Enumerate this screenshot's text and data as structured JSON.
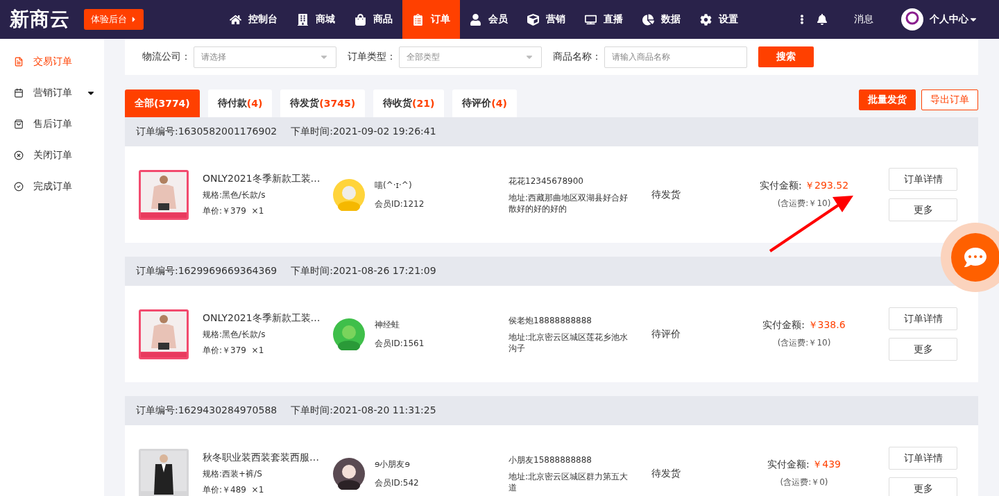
{
  "header": {
    "logo": "新商云",
    "trial_button": "体验后台",
    "nav": [
      {
        "label": "控制台",
        "selected": false
      },
      {
        "label": "商城",
        "selected": false
      },
      {
        "label": "商品",
        "selected": false
      },
      {
        "label": "订单",
        "selected": true
      },
      {
        "label": "会员",
        "selected": false
      },
      {
        "label": "营销",
        "selected": false
      },
      {
        "label": "直播",
        "selected": false
      },
      {
        "label": "数据",
        "selected": false
      },
      {
        "label": "设置",
        "selected": false
      }
    ],
    "messages": "消息",
    "user_menu": "个人中心"
  },
  "sidebar": {
    "items": [
      {
        "label": "交易订单",
        "selected": true,
        "has_submenu": false
      },
      {
        "label": "营销订单",
        "selected": false,
        "has_submenu": true
      },
      {
        "label": "售后订单",
        "selected": false,
        "has_submenu": false
      },
      {
        "label": "关闭订单",
        "selected": false,
        "has_submenu": false
      },
      {
        "label": "完成订单",
        "selected": false,
        "has_submenu": false
      }
    ]
  },
  "filters": [
    {
      "kind": "select",
      "label": "物流公司：",
      "placeholder": "请选择"
    },
    {
      "kind": "select",
      "label": "订单类型：",
      "placeholder": "全部类型"
    },
    {
      "kind": "input",
      "label": "商品名称：",
      "placeholder": "请输入商品名称"
    }
  ],
  "search_button": "搜索",
  "tabs": [
    {
      "label": "全部",
      "count": "(3774)",
      "selected": true
    },
    {
      "label": "待付款",
      "count": "(4)",
      "selected": false
    },
    {
      "label": "待发货",
      "count": "(3745)",
      "selected": false
    },
    {
      "label": "待收货",
      "count": "(21)",
      "selected": false
    },
    {
      "label": "待评价",
      "count": "(4)",
      "selected": false
    }
  ],
  "actions": [
    {
      "label": "批量发货",
      "kind": "primary"
    },
    {
      "label": "导出订单",
      "kind": "outline"
    }
  ],
  "orders": [
    {
      "order_no": "订单编号:1630582001176902",
      "order_time": "下单时间:2021-09-02 19:26:41",
      "product": "ONLY2021冬季新款工装…",
      "spec": "规格:黑色/长款/s",
      "price": "单价:￥379  ×1",
      "member": "喵(^·ɪ·^)",
      "member_id": "会员ID:1212",
      "contact": "花花12345678900",
      "address": "地址:西藏那曲地区双湖县好合好散好的好的好的",
      "status": "待发货",
      "paid_label": "实付金额:",
      "paid": "￥293.52",
      "shipping": "(含运费:￥10)",
      "buttons": [
        "订单详情",
        "更多"
      ]
    },
    {
      "order_no": "订单编号:1629969669364369",
      "order_time": "下单时间:2021-08-26 17:21:09",
      "product": "ONLY2021冬季新款工装…",
      "spec": "规格:黑色/长款/s",
      "price": "单价:￥379  ×1",
      "member": "神经蛙",
      "member_id": "会员ID:1561",
      "contact": "侯老炮18888888888",
      "address": "地址:北京密云区城区莲花乡池水沟子",
      "status": "待评价",
      "paid_label": "实付金额:",
      "paid": "￥338.6",
      "shipping": "(含运费:￥10)",
      "buttons": [
        "订单详情",
        "更多"
      ]
    },
    {
      "order_no": "订单编号:1629430284970588",
      "order_time": "下单时间:2021-08-20 11:31:25",
      "product": "秋冬职业装西装套装西服…",
      "spec": "规格:西装+裤/S",
      "price": "单价:￥489  ×1",
      "member": "ɘ小朋友ɘ",
      "member_id": "会员ID:542",
      "contact": "小朋友15888888888",
      "address": "地址:北京密云区城区群力第五大道",
      "status": "待发货",
      "paid_label": "实付金额:",
      "paid": "￥439",
      "shipping": "(含运费:￥0)",
      "buttons": [
        "订单详情",
        "更多"
      ]
    }
  ]
}
